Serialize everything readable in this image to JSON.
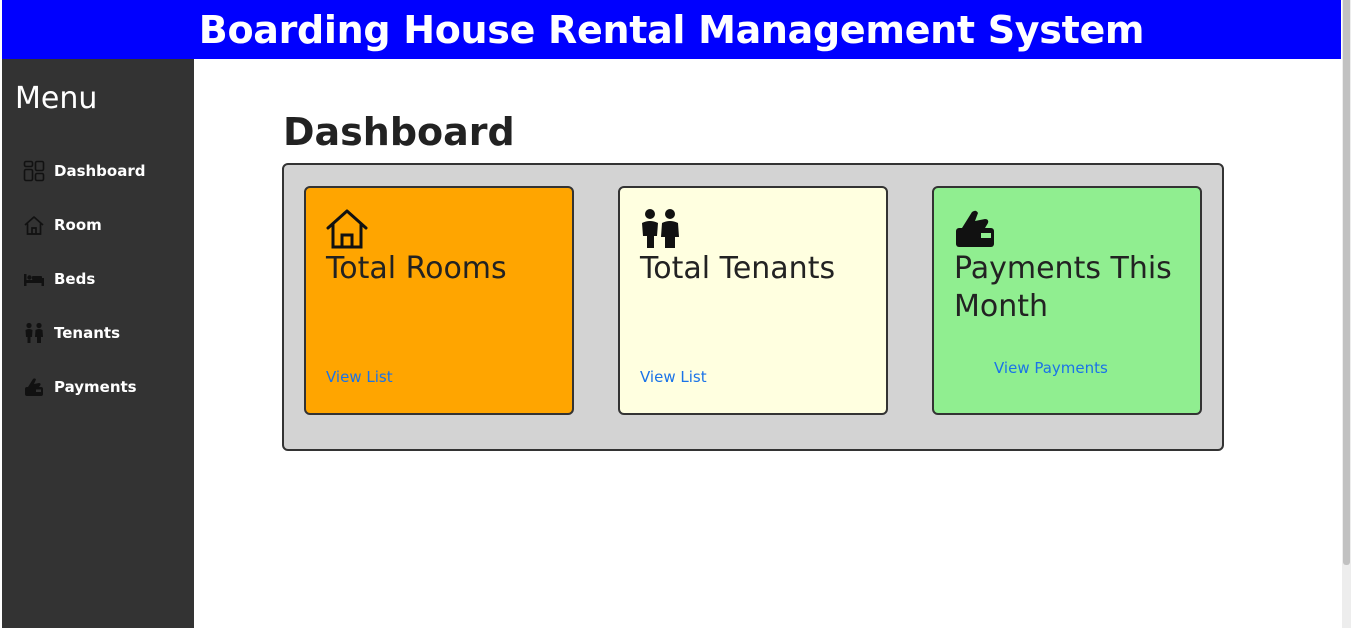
{
  "header": {
    "title": "Boarding House Rental Management System"
  },
  "sidebar": {
    "heading": "Menu",
    "items": [
      {
        "label": "Dashboard",
        "icon": "dashboard-icon"
      },
      {
        "label": "Room",
        "icon": "home-icon"
      },
      {
        "label": "Beds",
        "icon": "bed-icon"
      },
      {
        "label": "Tenants",
        "icon": "people-icon"
      },
      {
        "label": "Payments",
        "icon": "payment-icon"
      }
    ]
  },
  "main": {
    "title": "Dashboard",
    "cards": [
      {
        "title": "Total Rooms",
        "link": "View List",
        "icon": "home-icon",
        "color": "#ffa500"
      },
      {
        "title": "Total Tenants",
        "link": "View List",
        "icon": "people-icon",
        "color": "#ffffe0"
      },
      {
        "title": "Payments This Month",
        "link": "View Payments",
        "icon": "payment-icon",
        "color": "#90ee90"
      }
    ]
  },
  "colors": {
    "header_bg": "#0000ff",
    "sidebar_bg": "#333333",
    "panel_bg": "#d3d3d3",
    "link": "#1a73e8"
  }
}
